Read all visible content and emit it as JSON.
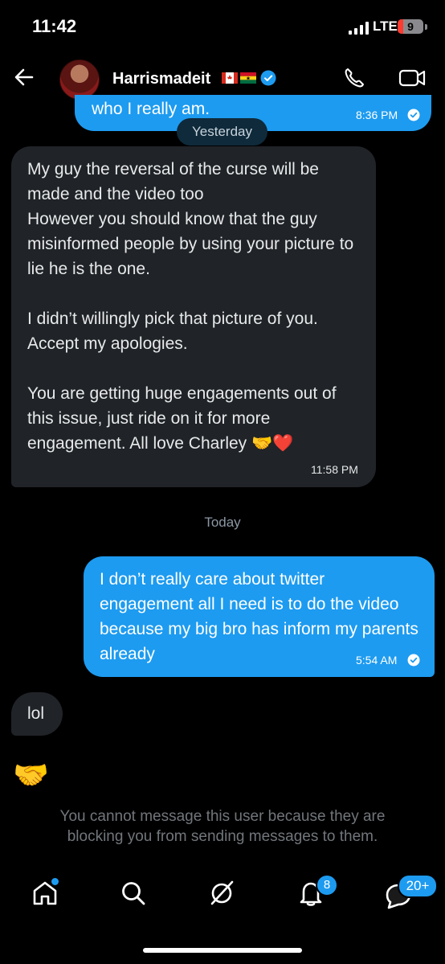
{
  "status_bar": {
    "time": "11:42",
    "network": "LTE",
    "battery": "9"
  },
  "header": {
    "name": "Harrismadeit",
    "verified": true
  },
  "messages": [
    {
      "direction": "outgoing",
      "text": "who I really am.",
      "time": "8:36 PM",
      "read": true
    },
    {
      "direction": "incoming",
      "text": "My guy the reversal of the curse will be made and the video too\nHowever you should know that the guy misinformed people by using your picture to lie he is the one.\n\nI didn’t willingly pick that picture of you. Accept my apologies.\n\nYou are getting huge engagements out of this issue, just ride on it for more engagement. All love Charley 🤝❤️",
      "time": "11:58 PM"
    },
    {
      "direction": "outgoing",
      "text": "I don’t really care about twitter engagement all I need is to do the video because my big bro has inform my parents already",
      "time": "5:54 AM",
      "read": true
    },
    {
      "direction": "incoming",
      "text": "lol"
    },
    {
      "direction": "incoming",
      "text": "🤝"
    }
  ],
  "dividers": {
    "yesterday": "Yesterday",
    "today": "Today"
  },
  "notice": "You cannot message this user because they are blocking you from sending messages to them.",
  "tab_bar": {
    "items": [
      "home-icon",
      "search-icon",
      "grok-icon",
      "notifications-icon",
      "messages-icon"
    ],
    "notifications_badge": "8",
    "messages_badge": "20+"
  },
  "colors": {
    "accent": "#1d9bf0",
    "incoming_bubble": "#202327",
    "background": "#000000"
  }
}
